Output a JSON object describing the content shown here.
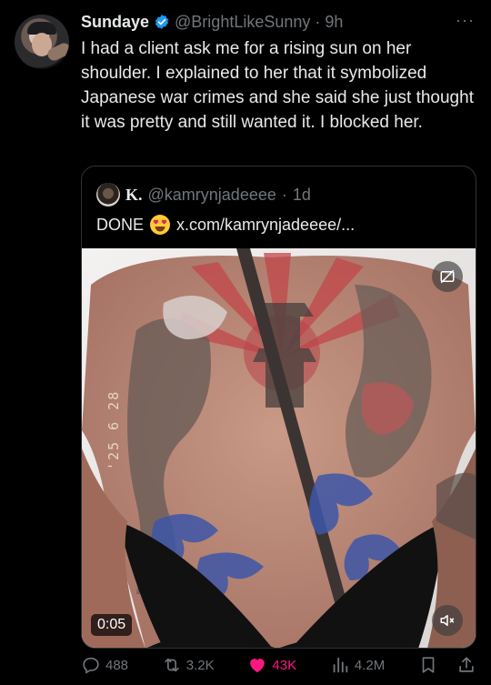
{
  "author": {
    "name": "Sundaye",
    "handle": "@BrightLikeSunny",
    "separator": "·",
    "time": "9h",
    "more": "···"
  },
  "tweet_text": "I had a client ask me for a rising sun on her shoulder. I explained to her that it symbolized Japanese war crimes and she said she just thought it was pretty and still wanted it. I blocked her.",
  "quote": {
    "name": "K.",
    "handle": "@kamrynjadeeee",
    "separator": "·",
    "time": "1d",
    "text": "DONE",
    "emoji": "heart-eyes-emoji",
    "link": "x.com/kamrynjadeeee/...",
    "video": {
      "timer": "0:05",
      "date_stamp": "'25 6 28"
    }
  },
  "actions": {
    "replies": "488",
    "reposts": "3.2K",
    "likes": "43K",
    "views": "4.2M"
  },
  "colors": {
    "background": "#000000",
    "text": "#e7e9ea",
    "muted": "#71767b",
    "verified": "#1d9bf0",
    "like": "#f91880",
    "border": "#2f3336"
  }
}
